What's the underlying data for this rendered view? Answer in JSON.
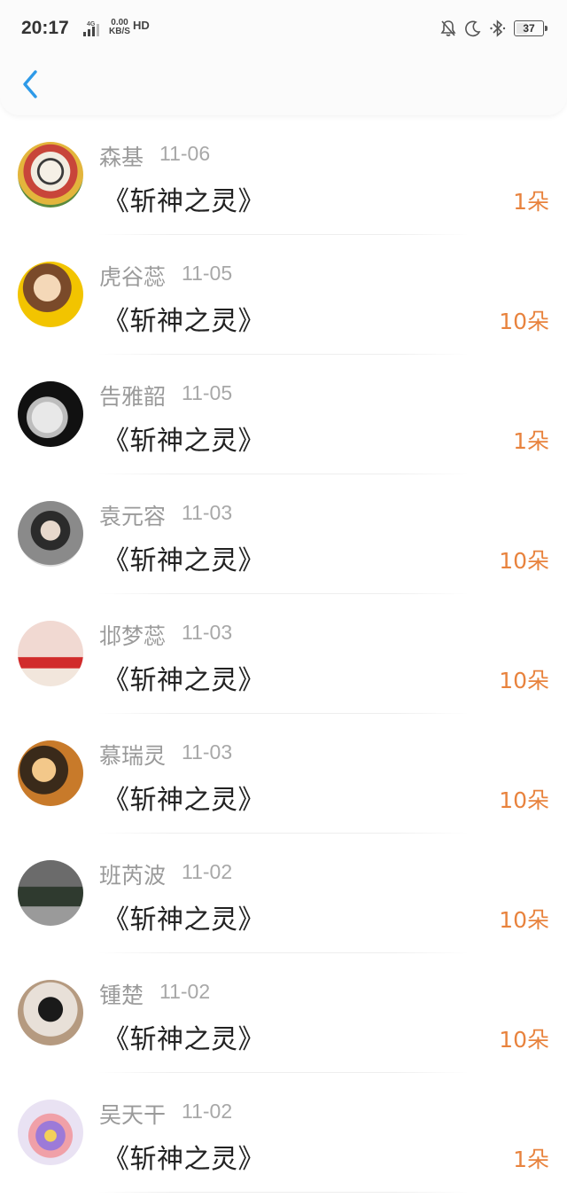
{
  "status_bar": {
    "time": "20:17",
    "network": "4G",
    "speed_value": "0.00",
    "speed_unit": "KB/S",
    "hd": "HD",
    "battery": "37"
  },
  "header": {
    "back_icon": "chevron-left-icon"
  },
  "colors": {
    "accent": "#2e9ae8",
    "amount": "#e8833e",
    "name": "#9a9a9a",
    "title": "#222222"
  },
  "gifts": [
    {
      "name": "森基",
      "date": "11-06",
      "gift": "《斩神之灵》",
      "amount": "1朵"
    },
    {
      "name": "虎谷蕊",
      "date": "11-05",
      "gift": "《斩神之灵》",
      "amount": "10朵"
    },
    {
      "name": "告雅韶",
      "date": "11-05",
      "gift": "《斩神之灵》",
      "amount": "1朵"
    },
    {
      "name": "袁元容",
      "date": "11-03",
      "gift": "《斩神之灵》",
      "amount": "10朵"
    },
    {
      "name": "邶梦蕊",
      "date": "11-03",
      "gift": "《斩神之灵》",
      "amount": "10朵"
    },
    {
      "name": "慕瑞灵",
      "date": "11-03",
      "gift": "《斩神之灵》",
      "amount": "10朵"
    },
    {
      "name": "班芮波",
      "date": "11-02",
      "gift": "《斩神之灵》",
      "amount": "10朵"
    },
    {
      "name": "锺楚",
      "date": "11-02",
      "gift": "《斩神之灵》",
      "amount": "10朵"
    },
    {
      "name": "吴天干",
      "date": "11-02",
      "gift": "《斩神之灵》",
      "amount": "1朵"
    }
  ]
}
